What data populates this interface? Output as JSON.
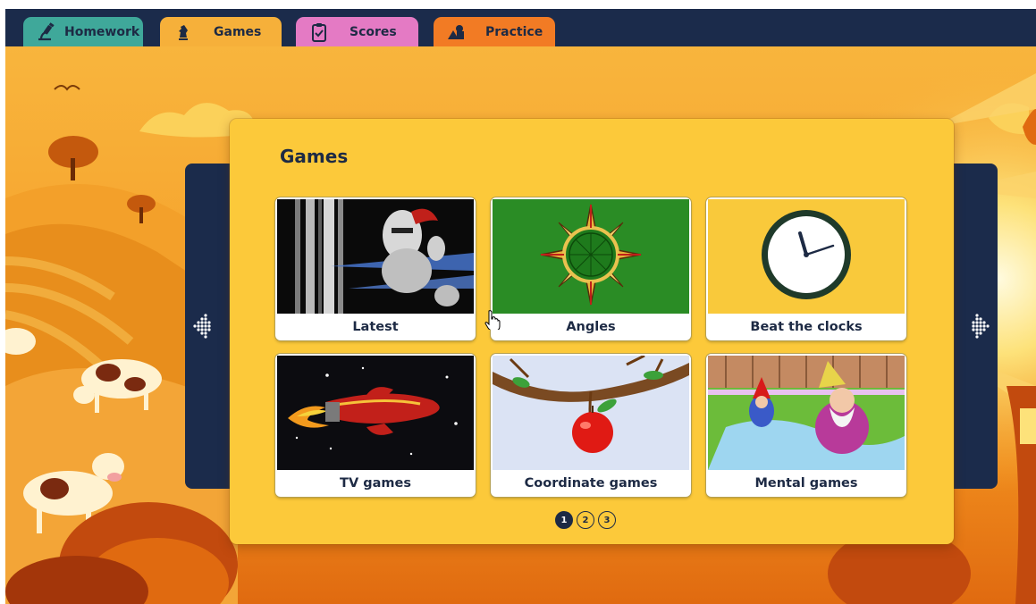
{
  "tabs": [
    {
      "label": "Homework",
      "icon": "microscope-icon",
      "color": "#3fa89a"
    },
    {
      "label": "Games",
      "icon": "chess-knight-icon",
      "color": "#f6b03a"
    },
    {
      "label": "Scores",
      "icon": "clipboard-check-icon",
      "color": "#e47ac4"
    },
    {
      "label": "Practice",
      "icon": "shapes-icon",
      "color": "#f27b24"
    }
  ],
  "panel": {
    "title": "Games",
    "tiles": [
      {
        "label": "Latest",
        "image": "knight-image"
      },
      {
        "label": "Angles",
        "image": "compass-image"
      },
      {
        "label": "Beat the clocks",
        "image": "clock-image"
      },
      {
        "label": "TV games",
        "image": "rocket-image"
      },
      {
        "label": "Coordinate games",
        "image": "apple-tree-image"
      },
      {
        "label": "Mental games",
        "image": "gnome-image"
      }
    ],
    "pages": [
      "1",
      "2",
      "3"
    ],
    "current_page": "1"
  },
  "nav": {
    "prev_icon": "dots-arrow-left-icon",
    "next_icon": "dots-arrow-right-icon"
  },
  "colors": {
    "navy": "#1b2b4b",
    "panel": "#fcc93a",
    "sky": "#f8b53d"
  }
}
